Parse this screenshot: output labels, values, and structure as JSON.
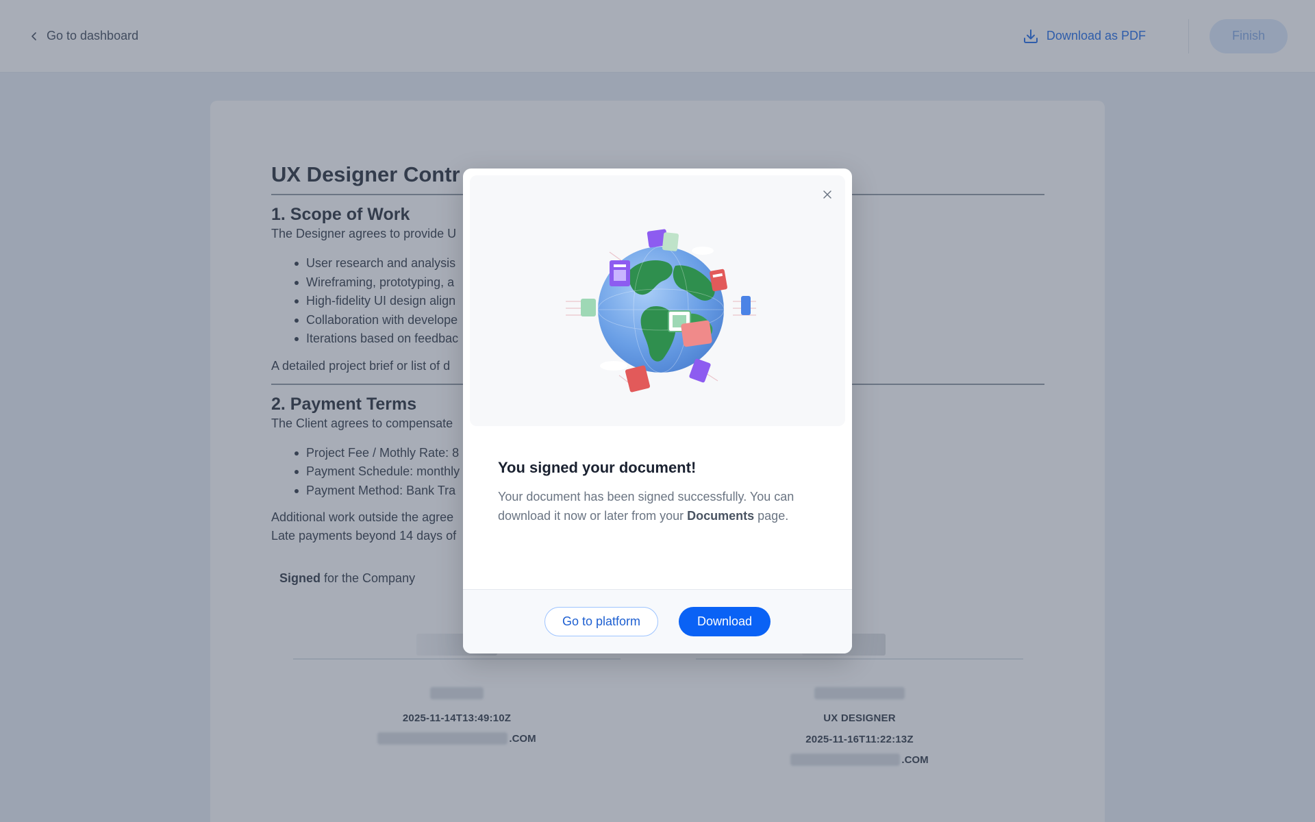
{
  "header": {
    "back_label": "Go to dashboard",
    "download_pdf_label": "Download as PDF",
    "finish_label": "Finish"
  },
  "document": {
    "title": "UX Designer Contr",
    "section1": {
      "heading": "1. Scope of Work",
      "intro": "The Designer agrees to provide U",
      "bullets": [
        "User research and analysis",
        "Wireframing, prototyping, a",
        "High-fidelity UI design align",
        "Collaboration with develope",
        "Iterations based on feedbac"
      ],
      "outro": "A detailed project brief or list of d"
    },
    "section2": {
      "heading": "2. Payment Terms",
      "intro": "The Client agrees to compensate",
      "bullets": [
        "Project Fee / Mothly Rate: 8",
        "Payment Schedule: monthly",
        "Payment Method: Bank Tra"
      ],
      "outro_line1": "Additional work outside the agree",
      "outro_line2": "Late payments beyond 14 days of"
    },
    "signed_bold": "Signed",
    "signed_rest": " for the Company",
    "signature_left": {
      "timestamp": "2025-11-14T13:49:10Z",
      "email_suffix": ".COM"
    },
    "signature_right": {
      "role": "UX DESIGNER",
      "timestamp": "2025-11-16T11:22:13Z",
      "email_suffix": ".COM"
    }
  },
  "modal": {
    "title": "You signed your document!",
    "text_before": "Your document has been signed successfully. You can download it now or later from your ",
    "text_link": "Documents",
    "text_after": " page.",
    "secondary_button": "Go to platform",
    "primary_button": "Download",
    "illustration": "globe-with-documents"
  },
  "colors": {
    "accent": "#0a62f5",
    "link": "#1766e6",
    "overlay": "#495468"
  }
}
